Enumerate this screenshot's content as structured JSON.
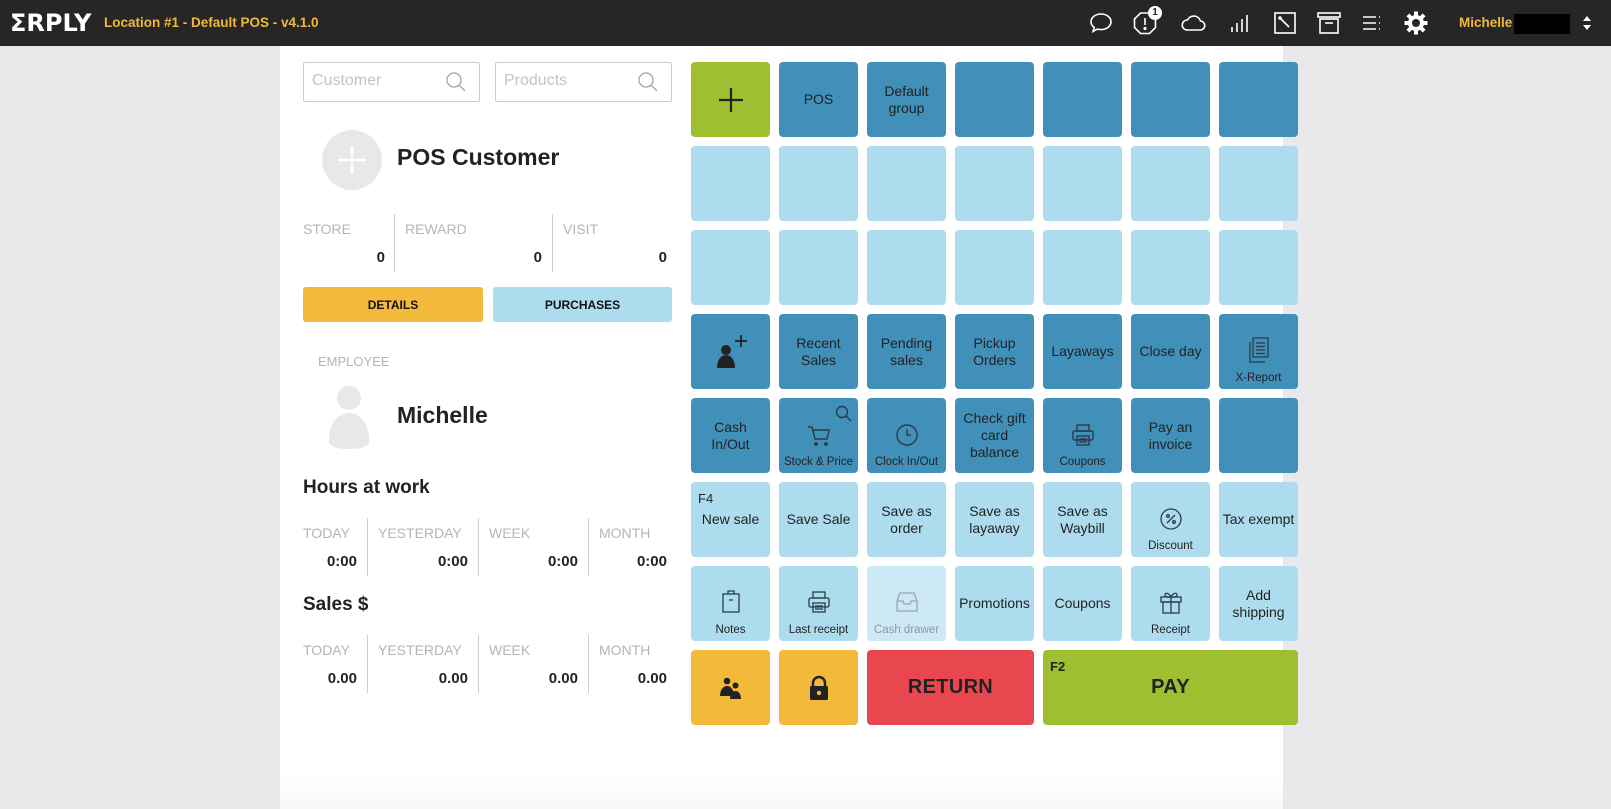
{
  "header": {
    "logo": "ΣRPLY",
    "title": "Location #1 - Default POS - v4.1.0",
    "icons": [
      "chat-icon",
      "alert-icon",
      "cloud-icon",
      "signal-icon",
      "edit-icon",
      "archive-icon",
      "menu-icon",
      "settings-icon"
    ],
    "alert_badge": "1",
    "user": "Michelle"
  },
  "search": {
    "customer_placeholder": "Customer",
    "customer_value": "",
    "products_placeholder": "Products",
    "products_value": ""
  },
  "customer": {
    "name": "POS Customer",
    "stats": [
      {
        "label": "STORE",
        "value": "0"
      },
      {
        "label": "REWARD",
        "value": "0"
      },
      {
        "label": "VISIT",
        "value": "0"
      }
    ],
    "details_button": "DETAILS",
    "purchases_button": "PURCHASES"
  },
  "employee": {
    "label": "EMPLOYEE",
    "name": "Michelle"
  },
  "hours": {
    "title": "Hours at work",
    "stats": [
      {
        "label": "TODAY",
        "value": "0:00"
      },
      {
        "label": "YESTERDAY",
        "value": "0:00"
      },
      {
        "label": "WEEK",
        "value": "0:00"
      },
      {
        "label": "MONTH",
        "value": "0:00"
      }
    ]
  },
  "sales": {
    "title": "Sales $",
    "stats": [
      {
        "label": "TODAY",
        "value": "0.00"
      },
      {
        "label": "YESTERDAY",
        "value": "0.00"
      },
      {
        "label": "WEEK",
        "value": "0.00"
      },
      {
        "label": "MONTH",
        "value": "0.00"
      }
    ]
  },
  "colors": {
    "header_bg": "#262626",
    "brand_yellow": "#f0b93a",
    "tile_dark": "#4190b9",
    "tile_light": "#aedcef",
    "tile_green": "#9ebf2f",
    "tile_yellow": "#f2b93b",
    "tile_red": "#e8474f"
  },
  "grid": {
    "product_groups": [
      "POS",
      "Default group"
    ],
    "functions": {
      "add_customer": "",
      "recent_sales": "Recent Sales",
      "pending_sales": "Pending sales",
      "pickup_orders": "Pickup Orders",
      "layaways": "Layaways",
      "close_day": "Close day",
      "x_report": "X-Report",
      "cash_in_out": "Cash In/Out",
      "stock_price": "Stock & Price",
      "clock_in_out": "Clock In/Out",
      "check_gift_card": "Check gift card balance",
      "coupons_print": "Coupons",
      "pay_invoice": "Pay an invoice",
      "new_sale_key": "F4",
      "new_sale": "New sale",
      "save_sale": "Save Sale",
      "save_order": "Save as order",
      "save_layaway": "Save as layaway",
      "save_waybill": "Save as Waybill",
      "discount": "Discount",
      "tax_exempt": "Tax exempt",
      "notes": "Notes",
      "last_receipt": "Last receipt",
      "cash_drawer": "Cash drawer",
      "promotions": "Promotions",
      "coupons": "Coupons",
      "gift_receipt": "Receipt",
      "add_shipping": "Add shipping",
      "return": "RETURN",
      "pay_key": "F2",
      "pay": "PAY"
    }
  }
}
